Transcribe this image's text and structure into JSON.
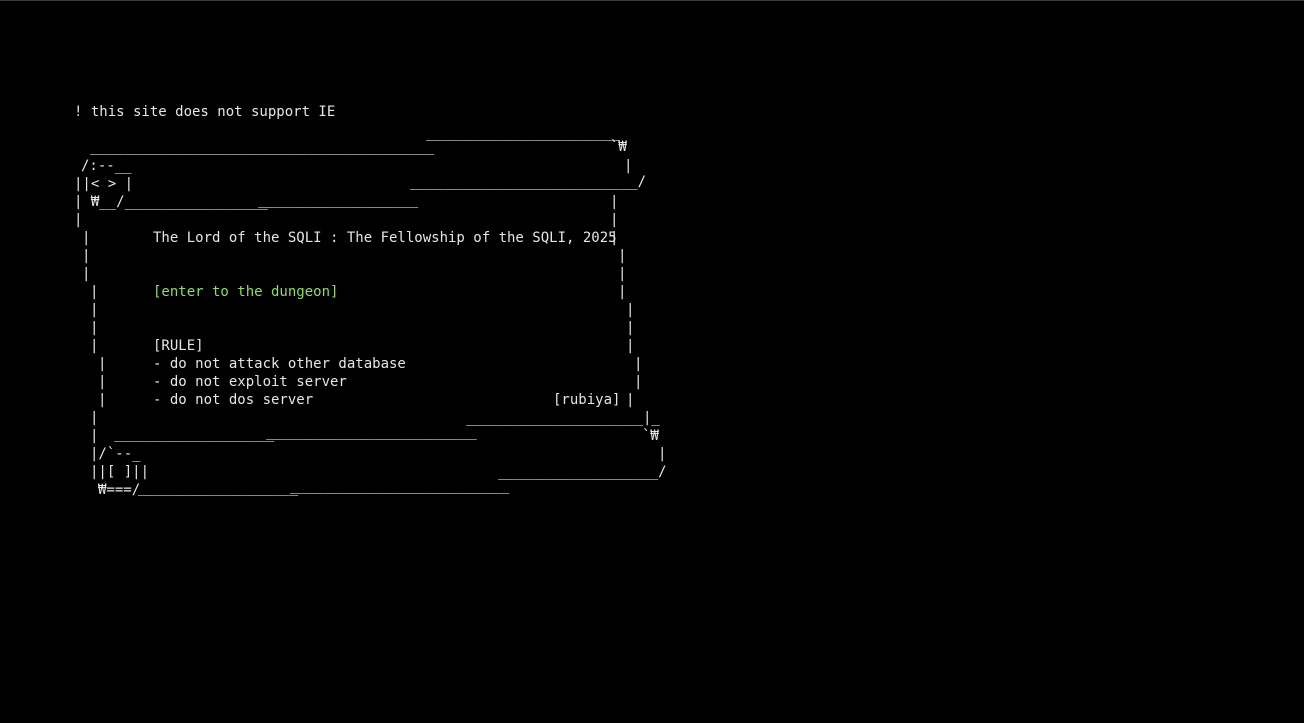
{
  "notice": "! this site does not support IE",
  "title": "The Lord of the SQLI : The Fellowship of the SQLI, 2025",
  "enter_link": "[enter to the dungeon]",
  "rules": {
    "heading": "[RULE]",
    "items": [
      "- do not attack other database",
      "- do not exploit server",
      "- do not dos server"
    ]
  },
  "author": "[rubiya]",
  "colors": {
    "background": "#000000",
    "text": "#e6e6e6",
    "link": "#8fdc6c"
  }
}
